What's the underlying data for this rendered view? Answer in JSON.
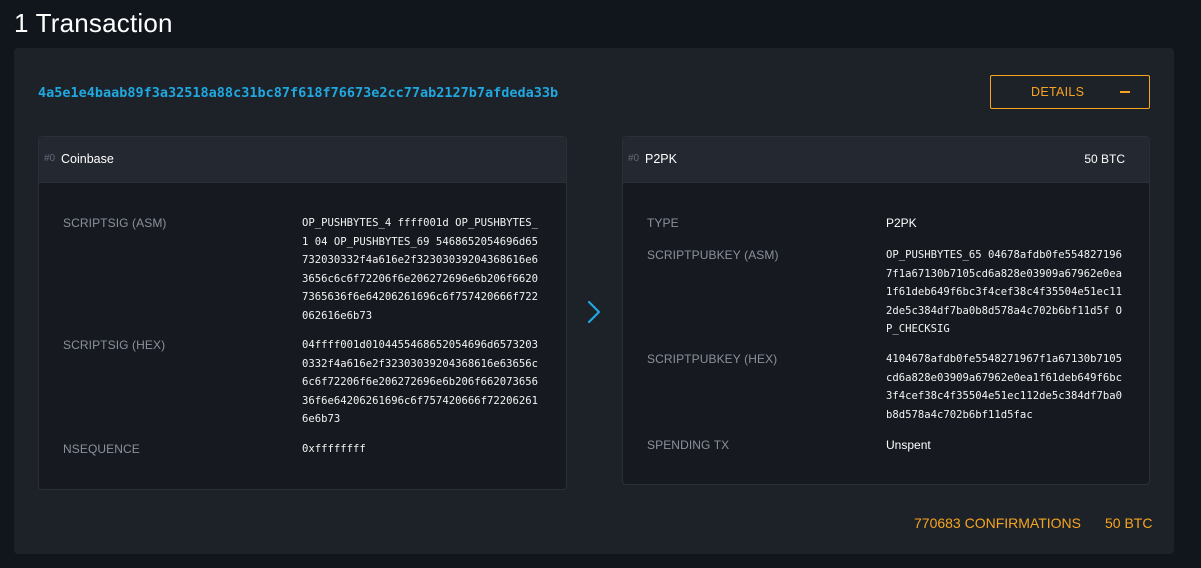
{
  "page": {
    "title": "1 Transaction"
  },
  "tx": {
    "txid": "4a5e1e4baab89f3a32518a88c31bc87f618f76673e2cc77ab2127b7afdeda33b",
    "details_label": "DETAILS"
  },
  "vin": {
    "index": "#0",
    "type": "Coinbase",
    "rows": [
      {
        "label": "SCRIPTSIG (ASM)",
        "value": "OP_PUSHBYTES_4 ffff001d OP_PUSHBYTES_1 04 OP_PUSHBYTES_69 5468652054696d65732030332f4a616e2f32303039204368616e63656c6c6f72206f6e206272696e6b206f66207365636f6e64206261696c6f757420666f722062616e6b73"
      },
      {
        "label": "SCRIPTSIG (HEX)",
        "value": "04ffff001d0104455468652054696d65732030332f4a616e2f32303039204368616e63656c6c6f72206f6e206272696e6b206f66207365636f6e64206261696c6f757420666f722062616e6b73"
      },
      {
        "label": "NSEQUENCE",
        "value": "0xffffffff"
      }
    ]
  },
  "vout": {
    "index": "#0",
    "type": "P2PK",
    "value": "50 BTC",
    "rows": [
      {
        "label": "TYPE",
        "value": "P2PK"
      },
      {
        "label": "SCRIPTPUBKEY (ASM)",
        "value": "OP_PUSHBYTES_65 04678afdb0fe5548271967f1a67130b7105cd6a828e03909a67962e0ea1f61deb649f6bc3f4cef38c4f35504e51ec112de5c384df7ba0b8d578a4c702b6bf11d5f OP_CHECKSIG"
      },
      {
        "label": "SCRIPTPUBKEY (HEX)",
        "value": "4104678afdb0fe5548271967f1a67130b7105cd6a828e03909a67962e0ea1f61deb649f6bc3f4cef38c4f35504e51ec112de5c384df7ba0b8d578a4c702b6bf11d5fac"
      },
      {
        "label": "SPENDING TX",
        "value": "Unspent"
      }
    ]
  },
  "footer": {
    "confirmations": "770683 CONFIRMATIONS",
    "total": "50 BTC"
  },
  "colors": {
    "accent": "#f7a520",
    "link": "#20a8e0",
    "background": "#11161d",
    "card": "#1d2128"
  },
  "icons": {
    "arrow": "chevron-right-icon",
    "collapse": "minus-icon"
  }
}
